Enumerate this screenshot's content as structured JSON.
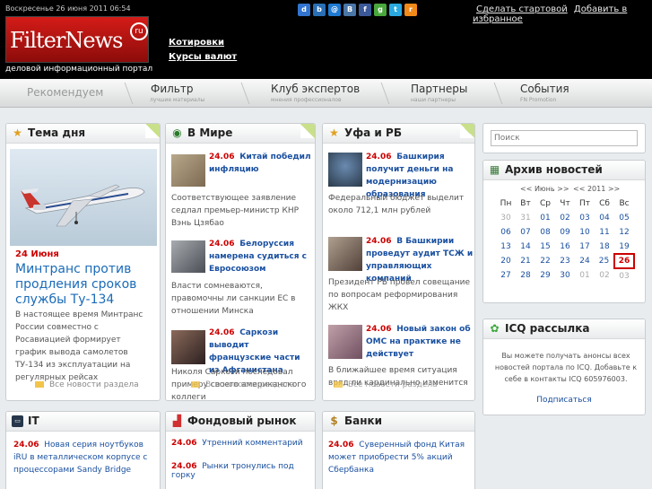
{
  "header": {
    "dateline": "Воскресенье 26 июня 2011 06:54",
    "logo_text": "FilterNews",
    "logo_badge": "ru",
    "tagline": "деловой информационный портал",
    "links": [
      "Котировки",
      "Курсы валют"
    ],
    "make_home": "Сделать стартовой",
    "add_favorites": "Добавить в избранное",
    "share_icons": [
      {
        "name": "delicious-icon",
        "glyph": "d",
        "color": "#3274d0"
      },
      {
        "name": "bookmark-icon",
        "glyph": "b",
        "color": "#2a6fb5"
      },
      {
        "name": "mail-icon",
        "glyph": "@",
        "color": "#1e7ad1"
      },
      {
        "name": "vkontakte-icon",
        "glyph": "B",
        "color": "#4a76a8"
      },
      {
        "name": "facebook-icon",
        "glyph": "f",
        "color": "#3b5998"
      },
      {
        "name": "google-icon",
        "glyph": "g",
        "color": "#49a83c"
      },
      {
        "name": "twitter-icon",
        "glyph": "t",
        "color": "#2aa9e0"
      },
      {
        "name": "rss-icon",
        "glyph": "r",
        "color": "#f28a1a"
      }
    ]
  },
  "nav": [
    {
      "title": "Рекомендуем",
      "sub": ""
    },
    {
      "title": "Фильтр",
      "sub": "лучшие материалы"
    },
    {
      "title": "Клуб экспертов",
      "sub": "мнения профессионалов"
    },
    {
      "title": "Партнеры",
      "sub": "наши партнеры"
    },
    {
      "title": "События",
      "sub": "FN Promotion"
    }
  ],
  "tema": {
    "header": "Тема дня",
    "date": "24 Июня",
    "title": "Минтранс против продления сроков службы Ту-134",
    "text": "В настоящее время Минтранс России совместно с Росавиацией формирует график вывода самолетов ТУ-134 из эксплуатации на регулярных рейсах",
    "more": "Все новости раздела"
  },
  "world": {
    "header": "В Мире",
    "items": [
      {
        "date": "24.06",
        "title": "Китай победил инфляцию",
        "text": "Соответствующее заявление седлал премьер-министр КНР Вэнь Цзябао"
      },
      {
        "date": "24.06",
        "title": "Белоруссия намерена судиться с Евросоюзом",
        "text": "Власти сомневаются, правомочны ли санкции ЕС в отношении Минска"
      },
      {
        "date": "24.06",
        "title": "Саркози выводит французские части из Афганистана",
        "text": "Николя Саркози последовал примеру своего американского коллеги"
      }
    ],
    "more": "Все новости раздела"
  },
  "ufa": {
    "header": "Уфа и РБ",
    "items": [
      {
        "date": "24.06",
        "title": "Башкирия получит деньги на модернизацию образования",
        "text": "Федеральный бюджет выделит около 712,1 млн рублей"
      },
      {
        "date": "24.06",
        "title": "В Башкирии проведут аудит ТСЖ и управляющих компаний",
        "text": "Президент РБ провел совещание по вопросам реформирования ЖКХ"
      },
      {
        "date": "24.06",
        "title": "Новый закон об ОМС на практике не действует",
        "text": "В ближайшее время ситуация вряд ли кардинально изменится"
      }
    ],
    "more": "Все новости раздела"
  },
  "search": {
    "placeholder": "Поиск"
  },
  "archive": {
    "header": "Архив новостей",
    "month": "<< Июнь >>",
    "year": "<< 2011 >>",
    "weekdays": [
      "Пн",
      "Вт",
      "Ср",
      "Чт",
      "Пт",
      "Сб",
      "Вс"
    ],
    "weeks": [
      [
        "30",
        "31",
        "01",
        "02",
        "03",
        "04",
        "05"
      ],
      [
        "06",
        "07",
        "08",
        "09",
        "10",
        "11",
        "12"
      ],
      [
        "13",
        "14",
        "15",
        "16",
        "17",
        "18",
        "19"
      ],
      [
        "20",
        "21",
        "22",
        "23",
        "24",
        "25",
        "26"
      ],
      [
        "27",
        "28",
        "29",
        "30",
        "01",
        "02",
        "03"
      ]
    ],
    "today": "26"
  },
  "icq": {
    "header": "ICQ рассылка",
    "text": "Вы можете получать анонсы всех новостей портала по ICQ. Добавьте к себе в контакты ICQ 605976003.",
    "subscribe": "Подписаться"
  },
  "it": {
    "header": "IT",
    "items": [
      {
        "date": "24.06",
        "title": "Новая серия ноутбуков iRU в металлическом корпусе с процессорами Sandy Bridge"
      }
    ]
  },
  "stock": {
    "header": "Фондовый рынок",
    "items": [
      {
        "date": "24.06",
        "title": "Утренний комментарий"
      },
      {
        "date": "24.06",
        "title": "Рынки тронулись под горку"
      }
    ]
  },
  "banks": {
    "header": "Банки",
    "items": [
      {
        "date": "24.06",
        "title": "Суверенный фонд Китая может приобрести 5% акций Сбербанка"
      }
    ]
  }
}
